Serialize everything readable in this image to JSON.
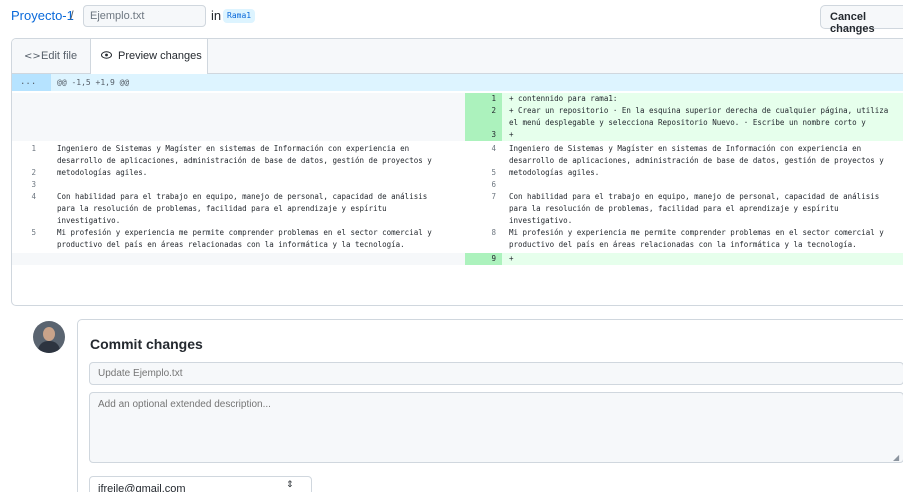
{
  "header": {
    "repo": "Proyecto-1",
    "separator": "/",
    "filename": "Ejemplo.txt",
    "in_label": "in",
    "branch": "Rama1",
    "cancel_label": "Cancel changes"
  },
  "tabs": {
    "edit": {
      "icon": "code-icon",
      "label": "Edit file"
    },
    "preview": {
      "icon": "eye-icon",
      "label": "Preview changes"
    }
  },
  "hunk": {
    "expander": "...",
    "header": "@@ -1,5 +1,9 @@"
  },
  "diff": {
    "added_top": [
      {
        "num": "1",
        "text": "+ contennido para rama1:"
      },
      {
        "num": "2",
        "text": "+ Crear un repositorio · En la esquina superior derecha de cualquier página, utiliza"
      },
      {
        "num": "",
        "text": "  el menú desplegable y selecciona Repositorio Nuevo. · Escribe un nombre corto y"
      },
      {
        "num": "3",
        "text": "+"
      }
    ],
    "context": [
      {
        "l": "1",
        "r": "4",
        "text": "Ingeniero de Sistemas y Magíster en sistemas de Información con experiencia en"
      },
      {
        "l": "",
        "r": "",
        "text": "desarrollo de aplicaciones, administración de base de datos, gestión de proyectos y"
      },
      {
        "l": "2",
        "r": "5",
        "text": "metodologías agiles."
      },
      {
        "l": "3",
        "r": "6",
        "text": ""
      },
      {
        "l": "4",
        "r": "7",
        "text": "Con habilidad para el trabajo en equipo, manejo de personal, capacidad de análisis"
      },
      {
        "l": "",
        "r": "",
        "text": "para la resolución de problemas, facilidad para el aprendizaje y espíritu"
      },
      {
        "l": "",
        "r": "",
        "text": "investigativo."
      },
      {
        "l": "5",
        "r": "8",
        "text": "Mi profesión y experiencia me permite comprender problemas en el sector comercial y"
      },
      {
        "l": "",
        "r": "",
        "text": "productivo del país en áreas relacionadas con la informática y la tecnología."
      }
    ],
    "added_bottom": {
      "num": "9",
      "text": "+"
    }
  },
  "commit": {
    "title": "Commit changes",
    "summary_placeholder": "Update Ejemplo.txt",
    "description_placeholder": "Add an optional extended description...",
    "email": "jfreile@gmail.com"
  },
  "colors": {
    "added_bg": "#e6ffec",
    "added_num_bg": "#acf2bd",
    "hunk_bg": "#ddf4ff",
    "link": "#0969da"
  }
}
